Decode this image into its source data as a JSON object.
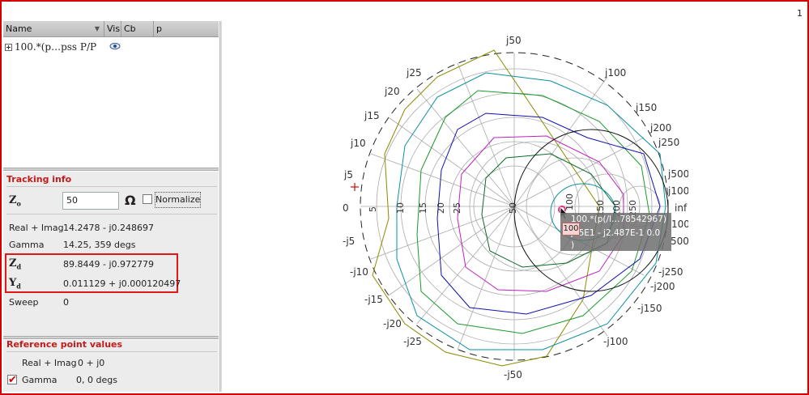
{
  "window": {
    "corner_number": "1"
  },
  "tree": {
    "columns": [
      "Name",
      "Vis",
      "Cb",
      "p"
    ],
    "rows": [
      {
        "name": "100.*(p…pss P/P",
        "visible": true
      }
    ]
  },
  "tracking": {
    "title": "Tracking info",
    "z0_symbol": "Z",
    "z0_sub": "o",
    "z0_value": "50",
    "ohm": "Ω",
    "normalize_label": "Normalize",
    "normalize_checked": false,
    "rows": [
      {
        "label": "Real + Imag",
        "value": "14.2478 - j0.248697"
      },
      {
        "label": "Gamma",
        "value": "14.25, 359 degs"
      }
    ],
    "zd": {
      "sym": "Z",
      "sub": "d",
      "value": "89.8449 - j0.972779"
    },
    "yd": {
      "sym": "Y",
      "sub": "d",
      "value": "0.011129 + j0.000120497"
    },
    "sweep": {
      "label": "Sweep",
      "value": "0"
    }
  },
  "reference": {
    "title": "Reference point values",
    "real_imag_label": "Real + Imag",
    "real_imag_value": "0 + j0",
    "gamma_label": "Gamma",
    "gamma_value": "0, 0 degs",
    "gamma_checked": true
  },
  "smith": {
    "reactance_labels": [
      "j5",
      "j10",
      "j15",
      "j20",
      "j25",
      "j50",
      "j100",
      "j150",
      "j200",
      "j250",
      "j500",
      "j1000",
      "inf",
      "-j5",
      "-j10",
      "-j15",
      "-j20",
      "-j25",
      "-j50",
      "-j100",
      "-j150",
      "-j200",
      "-j250",
      "-j500",
      "-j1000",
      "0",
      "1000",
      "500"
    ],
    "resistance_labels": [
      "5",
      "10",
      "15",
      "20",
      "25",
      "50",
      "100",
      "150",
      "200",
      "250"
    ],
    "marker_label": "100",
    "tooltip_lines": [
      "100.*(p(/l…78542967)",
      "j25E1 - j2.487E-1 0.0",
      ")"
    ],
    "colors": {
      "frame": "#d40000",
      "accent": "#c41a1a",
      "grid": "#bbbbbb",
      "marker": "#e0307a"
    }
  }
}
